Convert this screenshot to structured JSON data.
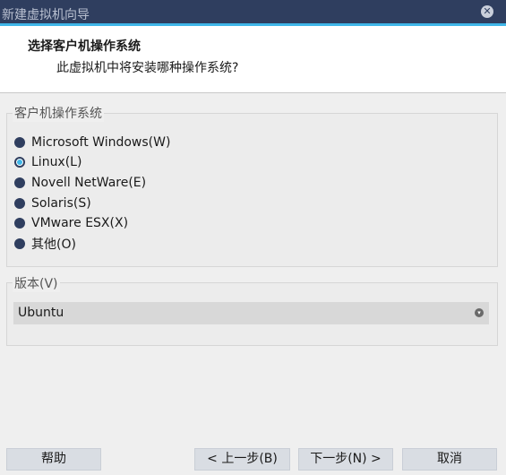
{
  "window": {
    "title": "新建虚拟机向导"
  },
  "header": {
    "heading": "选择客户机操作系统",
    "subheading": "此虚拟机中将安装哪种操作系统?"
  },
  "guest_os": {
    "group_label": "客户机操作系统",
    "options": [
      {
        "label": "Microsoft Windows(W)",
        "checked": false
      },
      {
        "label": "Linux(L)",
        "checked": true
      },
      {
        "label": "Novell NetWare(E)",
        "checked": false
      },
      {
        "label": "Solaris(S)",
        "checked": false
      },
      {
        "label": "VMware ESX(X)",
        "checked": false
      },
      {
        "label": "其他(O)",
        "checked": false
      }
    ]
  },
  "version": {
    "group_label": "版本(V)",
    "selected": "Ubuntu"
  },
  "buttons": {
    "help": "帮助",
    "back": "< 上一步(B)",
    "next": "下一步(N) >",
    "cancel": "取消"
  },
  "colors": {
    "titlebar": "#2f3e5f",
    "accent": "#3fb6e8",
    "radio": "#2f3e5f"
  },
  "icons": {
    "close": "close-circle-icon",
    "dropdown": "chevron-down-circle-icon"
  }
}
